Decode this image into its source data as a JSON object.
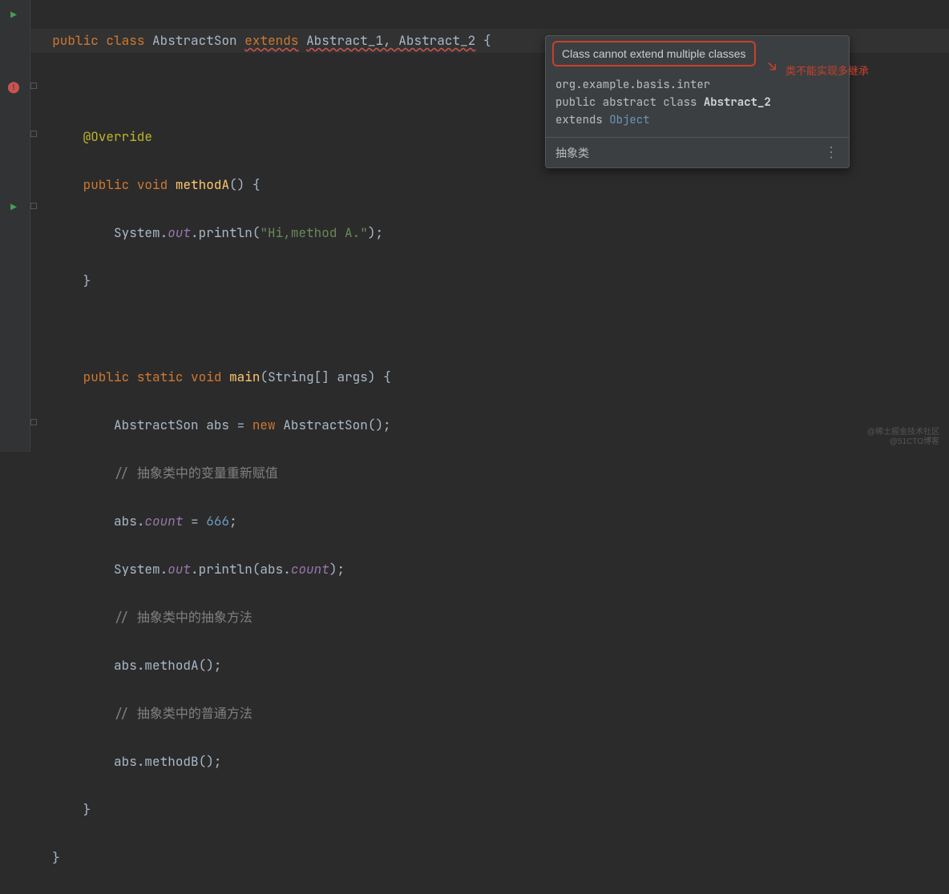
{
  "code": {
    "l1_pre": "  ",
    "l1_kw1": "public",
    "l1_kw2": "class",
    "l1_cls": "AbstractSon",
    "l1_ext": "extends",
    "l1_err": "Abstract_1, Abstract_2",
    "l1_end": " {",
    "l3_pre": "      ",
    "l3_ann": "@Override",
    "l4_pre": "      ",
    "l4_kw1": "public",
    "l4_kw2": "void",
    "l4_fn": "methodA",
    "l4_end": "() {",
    "l5_pre": "          ",
    "l5_sys": "System.",
    "l5_out": "out",
    "l5_prn": ".println(",
    "l5_str": "\"Hi,method A.\"",
    "l5_end": ");",
    "l6_pre": "      ",
    "l6_br": "}",
    "l8_pre": "      ",
    "l8_kw1": "public",
    "l8_kw2": "static",
    "l8_kw3": "void",
    "l8_fn": "main",
    "l8_end": "(String[] args) {",
    "l9_pre": "          ",
    "l9_typ": "AbstractSon abs = ",
    "l9_new": "new",
    "l9_end": " AbstractSon();",
    "l10_pre": "          ",
    "l10_cmt": "// 抽象类中的变量重新赋值",
    "l11_pre": "          ",
    "l11_a": "abs.",
    "l11_f": "count",
    "l11_eq": " = ",
    "l11_n": "666",
    "l11_e": ";",
    "l12_pre": "          ",
    "l12_sys": "System.",
    "l12_out": "out",
    "l12_prn": ".println(abs.",
    "l12_f": "count",
    "l12_e": ");",
    "l13_pre": "          ",
    "l13_cmt": "// 抽象类中的抽象方法",
    "l14_pre": "          ",
    "l14": "abs.methodA();",
    "l15_pre": "          ",
    "l15_cmt": "// 抽象类中的普通方法",
    "l16_pre": "          ",
    "l16": "abs.methodB();",
    "l17_pre": "      ",
    "l17": "}",
    "l18_pre": "  ",
    "l18": "}"
  },
  "tooltip": {
    "title": "Class cannot extend multiple classes",
    "pkg": "org.example.basis.inter",
    "decl_kw": "public abstract class ",
    "decl_cls": "Abstract_2",
    "ext_kw": "extends ",
    "ext_cls": "Object",
    "footer": "抽象类"
  },
  "annotation": {
    "red_label": "类不能实现多继承",
    "arrow": "↘"
  },
  "watermark": {
    "l1": "@稀土掘金技术社区",
    "l2": "@51CTO博客"
  }
}
